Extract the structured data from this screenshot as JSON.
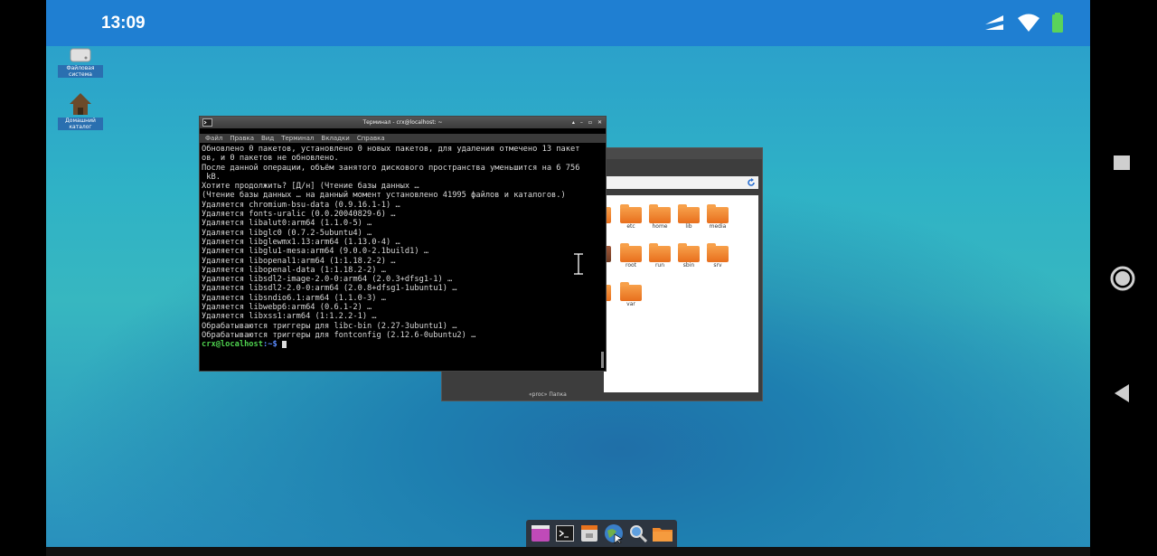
{
  "status_bar": {
    "time": "13:09"
  },
  "desktop_icons": [
    {
      "label": "Файловая система"
    },
    {
      "label": "Домашний каталог"
    }
  ],
  "terminal": {
    "title": "Терминал - crx@localhost: ~",
    "menu": [
      "Файл",
      "Правка",
      "Вид",
      "Терминал",
      "Вкладки",
      "Справка"
    ],
    "lines": [
      "Обновлено 0 пакетов, установлено 0 новых пакетов, для удаления отмечено 13 пакет",
      "ов, и 0 пакетов не обновлено.",
      "После данной операции, объём занятого дискового пространства уменьшится на 6 756",
      " kB.",
      "Хотите продолжить? [Д/н] (Чтение базы данных …",
      "(Чтение базы данных … на данный момент установлено 41995 файлов и каталогов.)",
      "Удаляется chromium-bsu-data (0.9.16.1-1) …",
      "Удаляется fonts-uralic (0.0.20040829-6) …",
      "Удаляется libalut0:arm64 (1.1.0-5) …",
      "Удаляется libglc0 (0.7.2-5ubuntu4) …",
      "Удаляется libglewmx1.13:arm64 (1.13.0-4) …",
      "Удаляется libglu1-mesa:arm64 (9.0.0-2.1build1) …",
      "Удаляется libopenal1:arm64 (1:1.18.2-2) …",
      "Удаляется libopenal-data (1:1.18.2-2) …",
      "Удаляется libsdl2-image-2.0-0:arm64 (2.0.3+dfsg1-1) …",
      "Удаляется libsdl2-2.0-0:arm64 (2.0.8+dfsg1-1ubuntu1) …",
      "Удаляется libsndio6.1:arm64 (1.1.0-3) …",
      "Удаляется libwebp6:arm64 (0.6.1-2) …",
      "Удаляется libxss1:arm64 (1:1.2.2-1) …",
      "Обрабатываются триггеры для libc-bin (2.27-3ubuntu1) …",
      "Обрабатываются триггеры для fontconfig (2.12.6-0ubuntu2) …"
    ],
    "prompt_user": "crx@localhost",
    "prompt_path": ":~",
    "prompt_symbol": "$"
  },
  "file_manager": {
    "status": "«proc» Папка",
    "folders_row1": [
      "etc",
      "home",
      "lib",
      "media"
    ],
    "folders_row2": [
      "root",
      "run",
      "sbin",
      "srv"
    ],
    "folders_row3": [
      "var"
    ]
  },
  "dock": {
    "items": [
      "app-menu-icon",
      "terminal-icon",
      "file-manager-icon",
      "web-browser-icon",
      "search-icon",
      "folder-icon"
    ]
  }
}
